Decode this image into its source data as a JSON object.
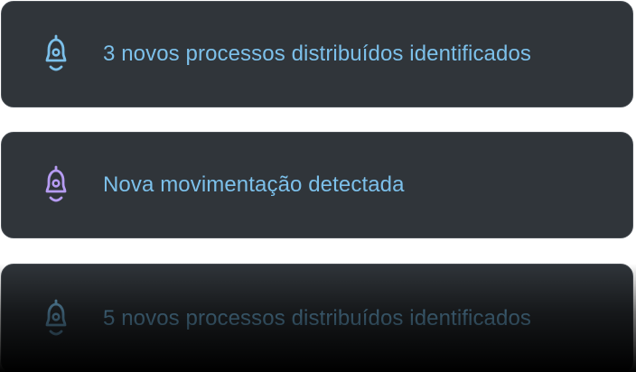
{
  "notifications": [
    {
      "text": "3 novos processos distribuídos identificados",
      "icon": "bell-icon",
      "icon_color": "#7cc0ea",
      "text_color": "#7cc0ea"
    },
    {
      "text": "Nova movimentação detectada",
      "icon": "bell-icon",
      "icon_color": "#b69cf2",
      "text_color": "#7cc0ea"
    },
    {
      "text": "5 novos processos distribuídos identificados",
      "icon": "bell-icon",
      "icon_color": "#7cc0ea",
      "text_color": "#7cc0ea"
    }
  ],
  "colors": {
    "card_background": "#30353a",
    "card_border": "#474d53",
    "page_background": "#ffffff"
  }
}
